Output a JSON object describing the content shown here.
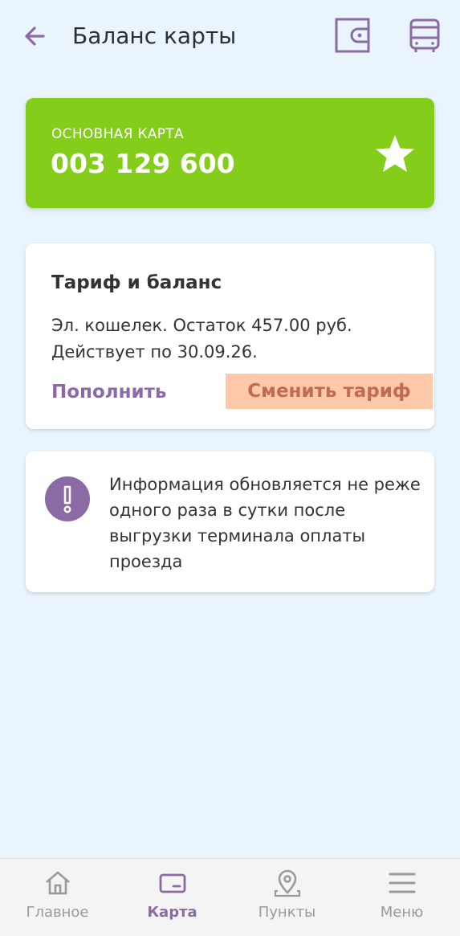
{
  "header": {
    "title": "Баланс карты",
    "back_icon": "arrow-left-icon",
    "wallet_icon": "wallet-icon",
    "bus_icon": "bus-icon"
  },
  "card": {
    "label": "ОСНОВНАЯ КАРТА",
    "number": "003 129 600",
    "favorite_icon": "star-icon",
    "color": "#84cd1b"
  },
  "tariff": {
    "title": "Тариф и баланс",
    "line1": "Эл. кошелек. Остаток 457.00 руб.",
    "line2": "Действует по 30.09.26.",
    "topup_label": "Пополнить",
    "change_label": "Сменить тариф"
  },
  "info": {
    "text": "Информация обновляется не реже одного раза в сутки после выгрузки терминала оплаты проезда",
    "icon": "exclamation-icon"
  },
  "nav": {
    "items": [
      {
        "label": "Главное",
        "icon": "home-icon",
        "active": false
      },
      {
        "label": "Карта",
        "icon": "card-icon",
        "active": true
      },
      {
        "label": "Пункты",
        "icon": "location-pin-icon",
        "active": false
      },
      {
        "label": "Меню",
        "icon": "menu-icon",
        "active": false
      }
    ]
  },
  "colors": {
    "accent": "#8c6aa3",
    "background": "#eaf4fd",
    "change_button": "#fdc9a8"
  }
}
